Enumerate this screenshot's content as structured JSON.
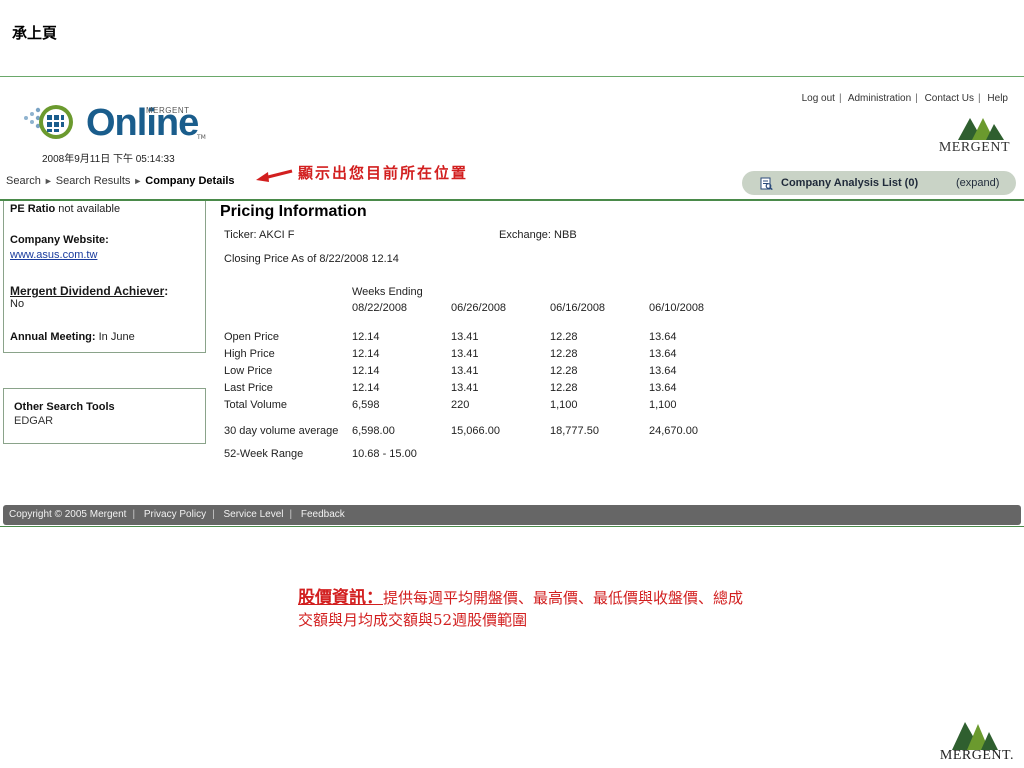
{
  "slide": {
    "title": "承上頁",
    "annotation_location": "顯示出您目前所在位置",
    "annotation_heading": "股價資訊：",
    "annotation_body_1": "提供每週平均開盤價、最高價、最低價與收盤價、總成",
    "annotation_body_2": "交額與月均成交額與52週股價範圍",
    "corner_brand": "MERGENT."
  },
  "header": {
    "logo_word": "Online",
    "logo_small": "MERGENT",
    "logo_tm": "TM",
    "timestamp": "2008年9月11日 下午 05:14:33",
    "links": [
      "Log out",
      "Administration",
      "Contact Us",
      "Help"
    ],
    "brand": "MERGENT"
  },
  "breadcrumb": {
    "items": [
      "Search",
      "Search Results"
    ],
    "current": "Company Details"
  },
  "analysis_list": {
    "label": "Company Analysis List (0)",
    "expand": "(expand)"
  },
  "sidebar": {
    "pe_label": "PE Ratio",
    "pe_value": "not available",
    "website_label": "Company Website:",
    "website_url": "www.asus.com.tw",
    "dividend_label": "Mergent Dividend Achiever",
    "dividend_colon": ":",
    "dividend_value": "No",
    "meeting_label": "Annual Meeting:",
    "meeting_value": "In June",
    "tools_title": "Other Search Tools",
    "tools_item": "EDGAR"
  },
  "pricing": {
    "title": "Pricing Information",
    "ticker": "Ticker: AKCI F",
    "exchange": "Exchange: NBB",
    "closing": "Closing Price As of 8/22/2008 12.14",
    "weeks_ending_label": "Weeks Ending",
    "dates": [
      "08/22/2008",
      "06/26/2008",
      "06/16/2008",
      "06/10/2008"
    ],
    "rows": [
      {
        "label": "Open Price",
        "values": [
          "12.14",
          "13.41",
          "12.28",
          "13.64"
        ]
      },
      {
        "label": "High Price",
        "values": [
          "12.14",
          "13.41",
          "12.28",
          "13.64"
        ]
      },
      {
        "label": "Low Price",
        "values": [
          "12.14",
          "13.41",
          "12.28",
          "13.64"
        ]
      },
      {
        "label": "Last Price",
        "values": [
          "12.14",
          "13.41",
          "12.28",
          "13.64"
        ]
      },
      {
        "label": "Total Volume",
        "values": [
          "6,598",
          "220",
          "1,100",
          "1,100"
        ]
      }
    ],
    "avg_row": {
      "label": "30 day volume average",
      "values": [
        "6,598.00",
        "15,066.00",
        "18,777.50",
        "24,670.00"
      ]
    },
    "range_label": "52-Week Range",
    "range_value": "10.68 - 15.00"
  },
  "footer": {
    "links": [
      "Copyright © 2005 Mergent",
      "Privacy Policy",
      "Service Level",
      "Feedback"
    ]
  },
  "colors": {
    "annotation": "#d21f1f",
    "brand_green": "#4a8a4a",
    "logo_blue": "#1a5d8c",
    "footer_bg": "#666666"
  }
}
